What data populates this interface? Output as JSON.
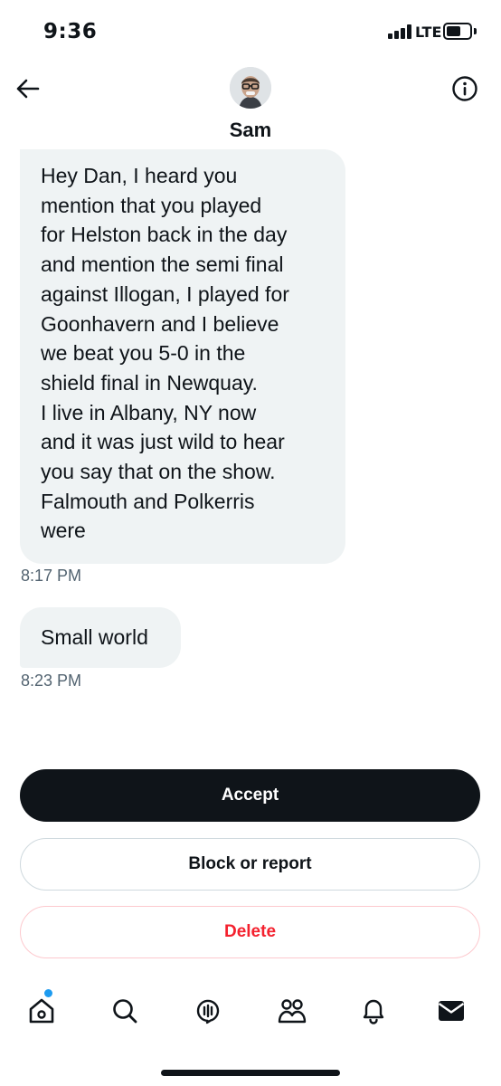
{
  "status_bar": {
    "time": "9:36",
    "network": "LTE"
  },
  "header": {
    "name": "Sam",
    "back_icon": "arrow-left-icon",
    "info_icon": "info-circle-icon"
  },
  "messages": [
    {
      "lines": [
        "Hey Dan, I heard you",
        "mention that you played",
        "for Helston back in the day",
        "and mention the semi final",
        "against Illogan, I played for",
        "Goonhavern and I believe",
        "we beat you 5-0 in the",
        "shield final in Newquay.",
        "I live in Albany, NY now",
        "and it was just wild to hear",
        "you say that on the show.",
        "Falmouth and Polkerris",
        "were"
      ],
      "time": "8:17 PM"
    },
    {
      "text": "Small world",
      "time": "8:23 PM"
    }
  ],
  "actions": {
    "accept": "Accept",
    "block_or_report": "Block or report",
    "delete": "Delete"
  },
  "tab_bar": {
    "icons": [
      "home-icon",
      "search-icon",
      "spaces-icon",
      "communities-icon",
      "notifications-icon",
      "messages-icon"
    ]
  },
  "colors": {
    "bubble": "#eff3f4",
    "primary_text": "#0f1419",
    "secondary_text": "#536471",
    "delete_red": "#f4212e",
    "notification_blue": "#1d9bf0"
  }
}
